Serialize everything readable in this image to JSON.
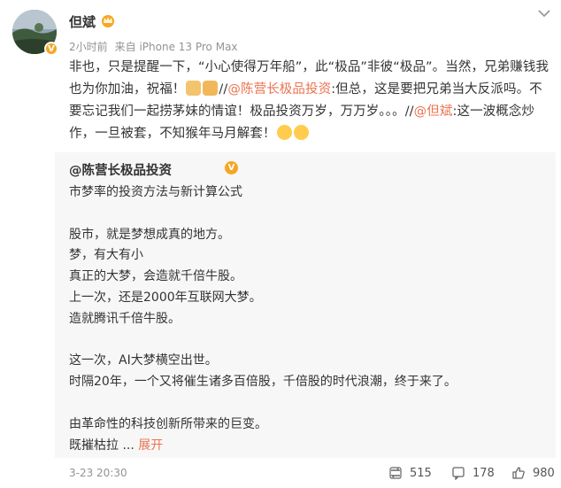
{
  "author": {
    "name": "但斌",
    "avatar_badge": "V"
  },
  "meta": {
    "time": "2小时前",
    "source": "来自 iPhone 13 Pro Max"
  },
  "post_text": {
    "seg1": "非也，只是提醒一下，“小心使得万年船”，此“极品”非彼“极品”。当然，兄弟赚钱我也为你加油，祝福！",
    "seg2": "//",
    "mention1": "@陈营长极品投资",
    "seg3": ":但总，这是要把兄弟当大反派吗。不要忘记我们一起捞茅妹的情谊！极品投资万岁，万万岁。。。//",
    "mention2": "@但斌",
    "seg4": ":这一波概念炒作，",
    "highlight": "一旦被套，不知猴年马月解套！"
  },
  "repost": {
    "author": "@陈营长极品投资",
    "vbadge": "V",
    "lines": [
      "市梦率的投资方法与新计算公式",
      "",
      "股市，就是梦想成真的地方。",
      "梦，有大有小",
      "真正的大梦，会造就千倍牛股。",
      "上一次，还是2000年互联网大梦。",
      "造就腾讯千倍牛股。",
      "",
      "这一次，AI大梦横空出世。",
      "时隔20年，一个又将催生诸多百倍股，千倍股的时代浪潮，终于来了。",
      "",
      "由革命性的科技创新所带来的巨变。"
    ],
    "last_line": "既摧枯拉",
    "ellipsis": " ... ",
    "expand_label": "展开"
  },
  "footer": {
    "date": "3-23 20:30",
    "reposts": "515",
    "comments": "178",
    "likes": "980"
  },
  "colors": {
    "link": "#eb7350",
    "underline": "#e2231a",
    "badge": "#f6a623"
  }
}
